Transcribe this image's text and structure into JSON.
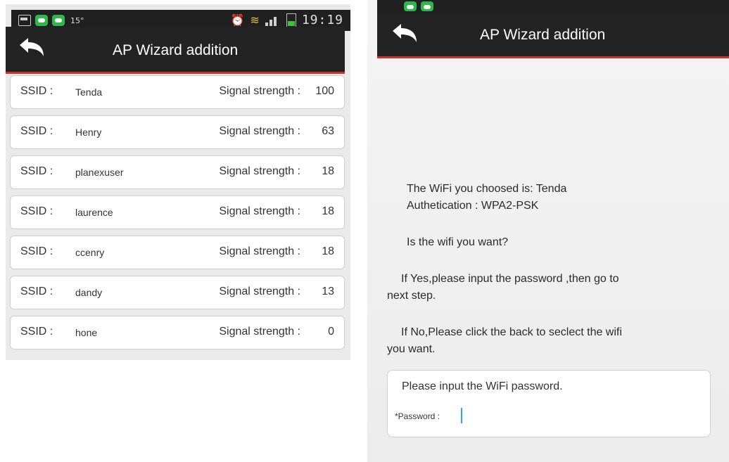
{
  "left": {
    "status_bar": {
      "temp": "15°",
      "time": "19:19",
      "icons": [
        "image-icon",
        "message-icon",
        "message-icon",
        "alarm-icon",
        "wifi-icon",
        "signal-icon",
        "battery-icon"
      ]
    },
    "action_bar": {
      "title": "AP Wizard addition",
      "back_icon": "back-arrow-icon"
    },
    "wifi_list": [
      {
        "ssid_label": "SSID :",
        "ssid": "Tenda",
        "signal_label": "Signal strength :",
        "signal": "100"
      },
      {
        "ssid_label": "SSID :",
        "ssid": "Henry",
        "signal_label": "Signal strength :",
        "signal": "63"
      },
      {
        "ssid_label": "SSID :",
        "ssid": "planexuser",
        "signal_label": "Signal strength :",
        "signal": "18"
      },
      {
        "ssid_label": "SSID :",
        "ssid": "laurence",
        "signal_label": "Signal strength :",
        "signal": "18"
      },
      {
        "ssid_label": "SSID :",
        "ssid": "ccenry",
        "signal_label": "Signal strength :",
        "signal": "18"
      },
      {
        "ssid_label": "SSID :",
        "ssid": "dandy",
        "signal_label": "Signal strength :",
        "signal": "13"
      },
      {
        "ssid_label": "SSID :",
        "ssid": "hone",
        "signal_label": "Signal strength :",
        "signal": "0"
      }
    ]
  },
  "right": {
    "action_bar": {
      "title": "AP Wizard addition",
      "back_icon": "back-arrow-icon"
    },
    "info": {
      "wifi_chosen": "The WiFi you choosed is:  Tenda",
      "auth": "Authetication :  WPA2-PSK",
      "question": "Is the wifi you want?",
      "yes_line1": "If Yes,please input the password ,then go to",
      "yes_line2": "next step.",
      "no_line1": "If No,Please click the back to seclect the wifi",
      "no_line2": "you want."
    },
    "password_box": {
      "hint": "Please input the WiFi password.",
      "label": "*Password :",
      "value": ""
    }
  },
  "colors": {
    "action_bar": "#232323",
    "accent_line": "#c9322a",
    "caret": "#3aa0e0"
  }
}
